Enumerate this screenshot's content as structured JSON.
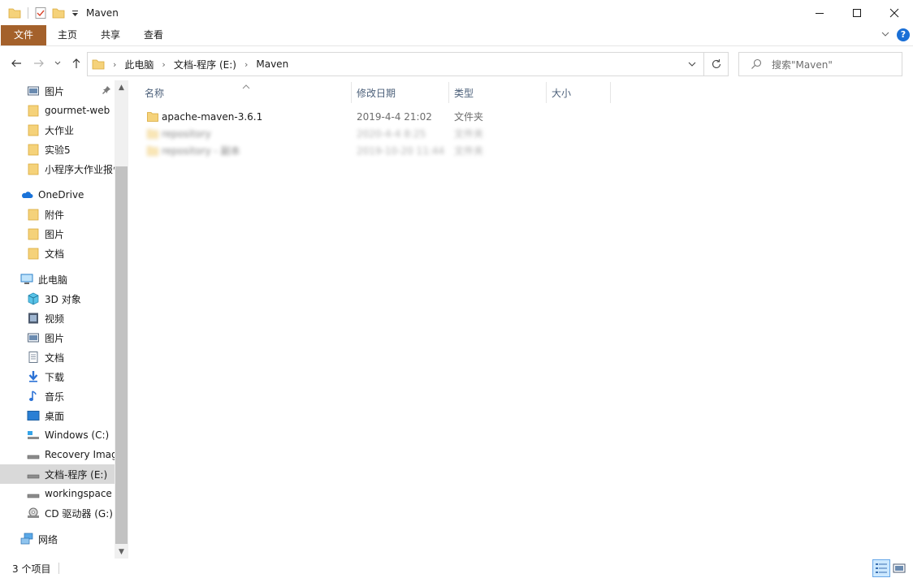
{
  "window": {
    "title": "Maven"
  },
  "ribbon": {
    "tabs": [
      "文件",
      "主页",
      "共享",
      "查看"
    ]
  },
  "address": {
    "crumbs": [
      "此电脑",
      "文档-程序 (E:)",
      "Maven"
    ]
  },
  "search": {
    "placeholder": "搜索\"Maven\""
  },
  "sidebar": {
    "items": [
      {
        "label": "图片",
        "icon": "pictures-icon",
        "pinned": true
      },
      {
        "label": "gourmet-web",
        "icon": "folder-icon"
      },
      {
        "label": "大作业",
        "icon": "folder-icon"
      },
      {
        "label": "实验5",
        "icon": "folder-icon"
      },
      {
        "label": "小程序大作业报告",
        "icon": "folder-icon"
      },
      {
        "label": "OneDrive",
        "icon": "onedrive-icon"
      },
      {
        "label": "附件",
        "icon": "folder-icon"
      },
      {
        "label": "图片",
        "icon": "folder-icon"
      },
      {
        "label": "文档",
        "icon": "folder-icon"
      },
      {
        "label": "此电脑",
        "icon": "computer-icon"
      },
      {
        "label": "3D 对象",
        "icon": "3d-objects-icon"
      },
      {
        "label": "视频",
        "icon": "video-icon"
      },
      {
        "label": "图片",
        "icon": "pictures-icon"
      },
      {
        "label": "文档",
        "icon": "documents-icon"
      },
      {
        "label": "下载",
        "icon": "download-icon"
      },
      {
        "label": "音乐",
        "icon": "music-icon"
      },
      {
        "label": "桌面",
        "icon": "desktop-icon"
      },
      {
        "label": "Windows (C:)",
        "icon": "drive-windows-icon"
      },
      {
        "label": "Recovery Image",
        "icon": "drive-icon"
      },
      {
        "label": "文档-程序 (E:)",
        "icon": "drive-icon",
        "selected": true
      },
      {
        "label": "workingspace",
        "icon": "drive-icon"
      },
      {
        "label": "CD 驱动器 (G:)",
        "icon": "cd-drive-icon"
      },
      {
        "label": "网络",
        "icon": "network-icon"
      }
    ]
  },
  "columns": {
    "name": "名称",
    "date": "修改日期",
    "type": "类型",
    "size": "大小"
  },
  "files": [
    {
      "name": "apache-maven-3.6.1",
      "date": "2019-4-4 21:02",
      "type": "文件夹",
      "blurred": false
    },
    {
      "name": "repository",
      "date": "2020-4-4 8:25",
      "type": "文件夹",
      "blurred": true
    },
    {
      "name": "repository - 副本",
      "date": "2019-10-20 11:44",
      "type": "文件夹",
      "blurred": true
    }
  ],
  "status": {
    "count": "3 个项目"
  },
  "colors": {
    "file_tab": "#a4612b",
    "folder": "#f5d27a",
    "selection": "#d9d9d9",
    "help": "#1a6fd6"
  }
}
